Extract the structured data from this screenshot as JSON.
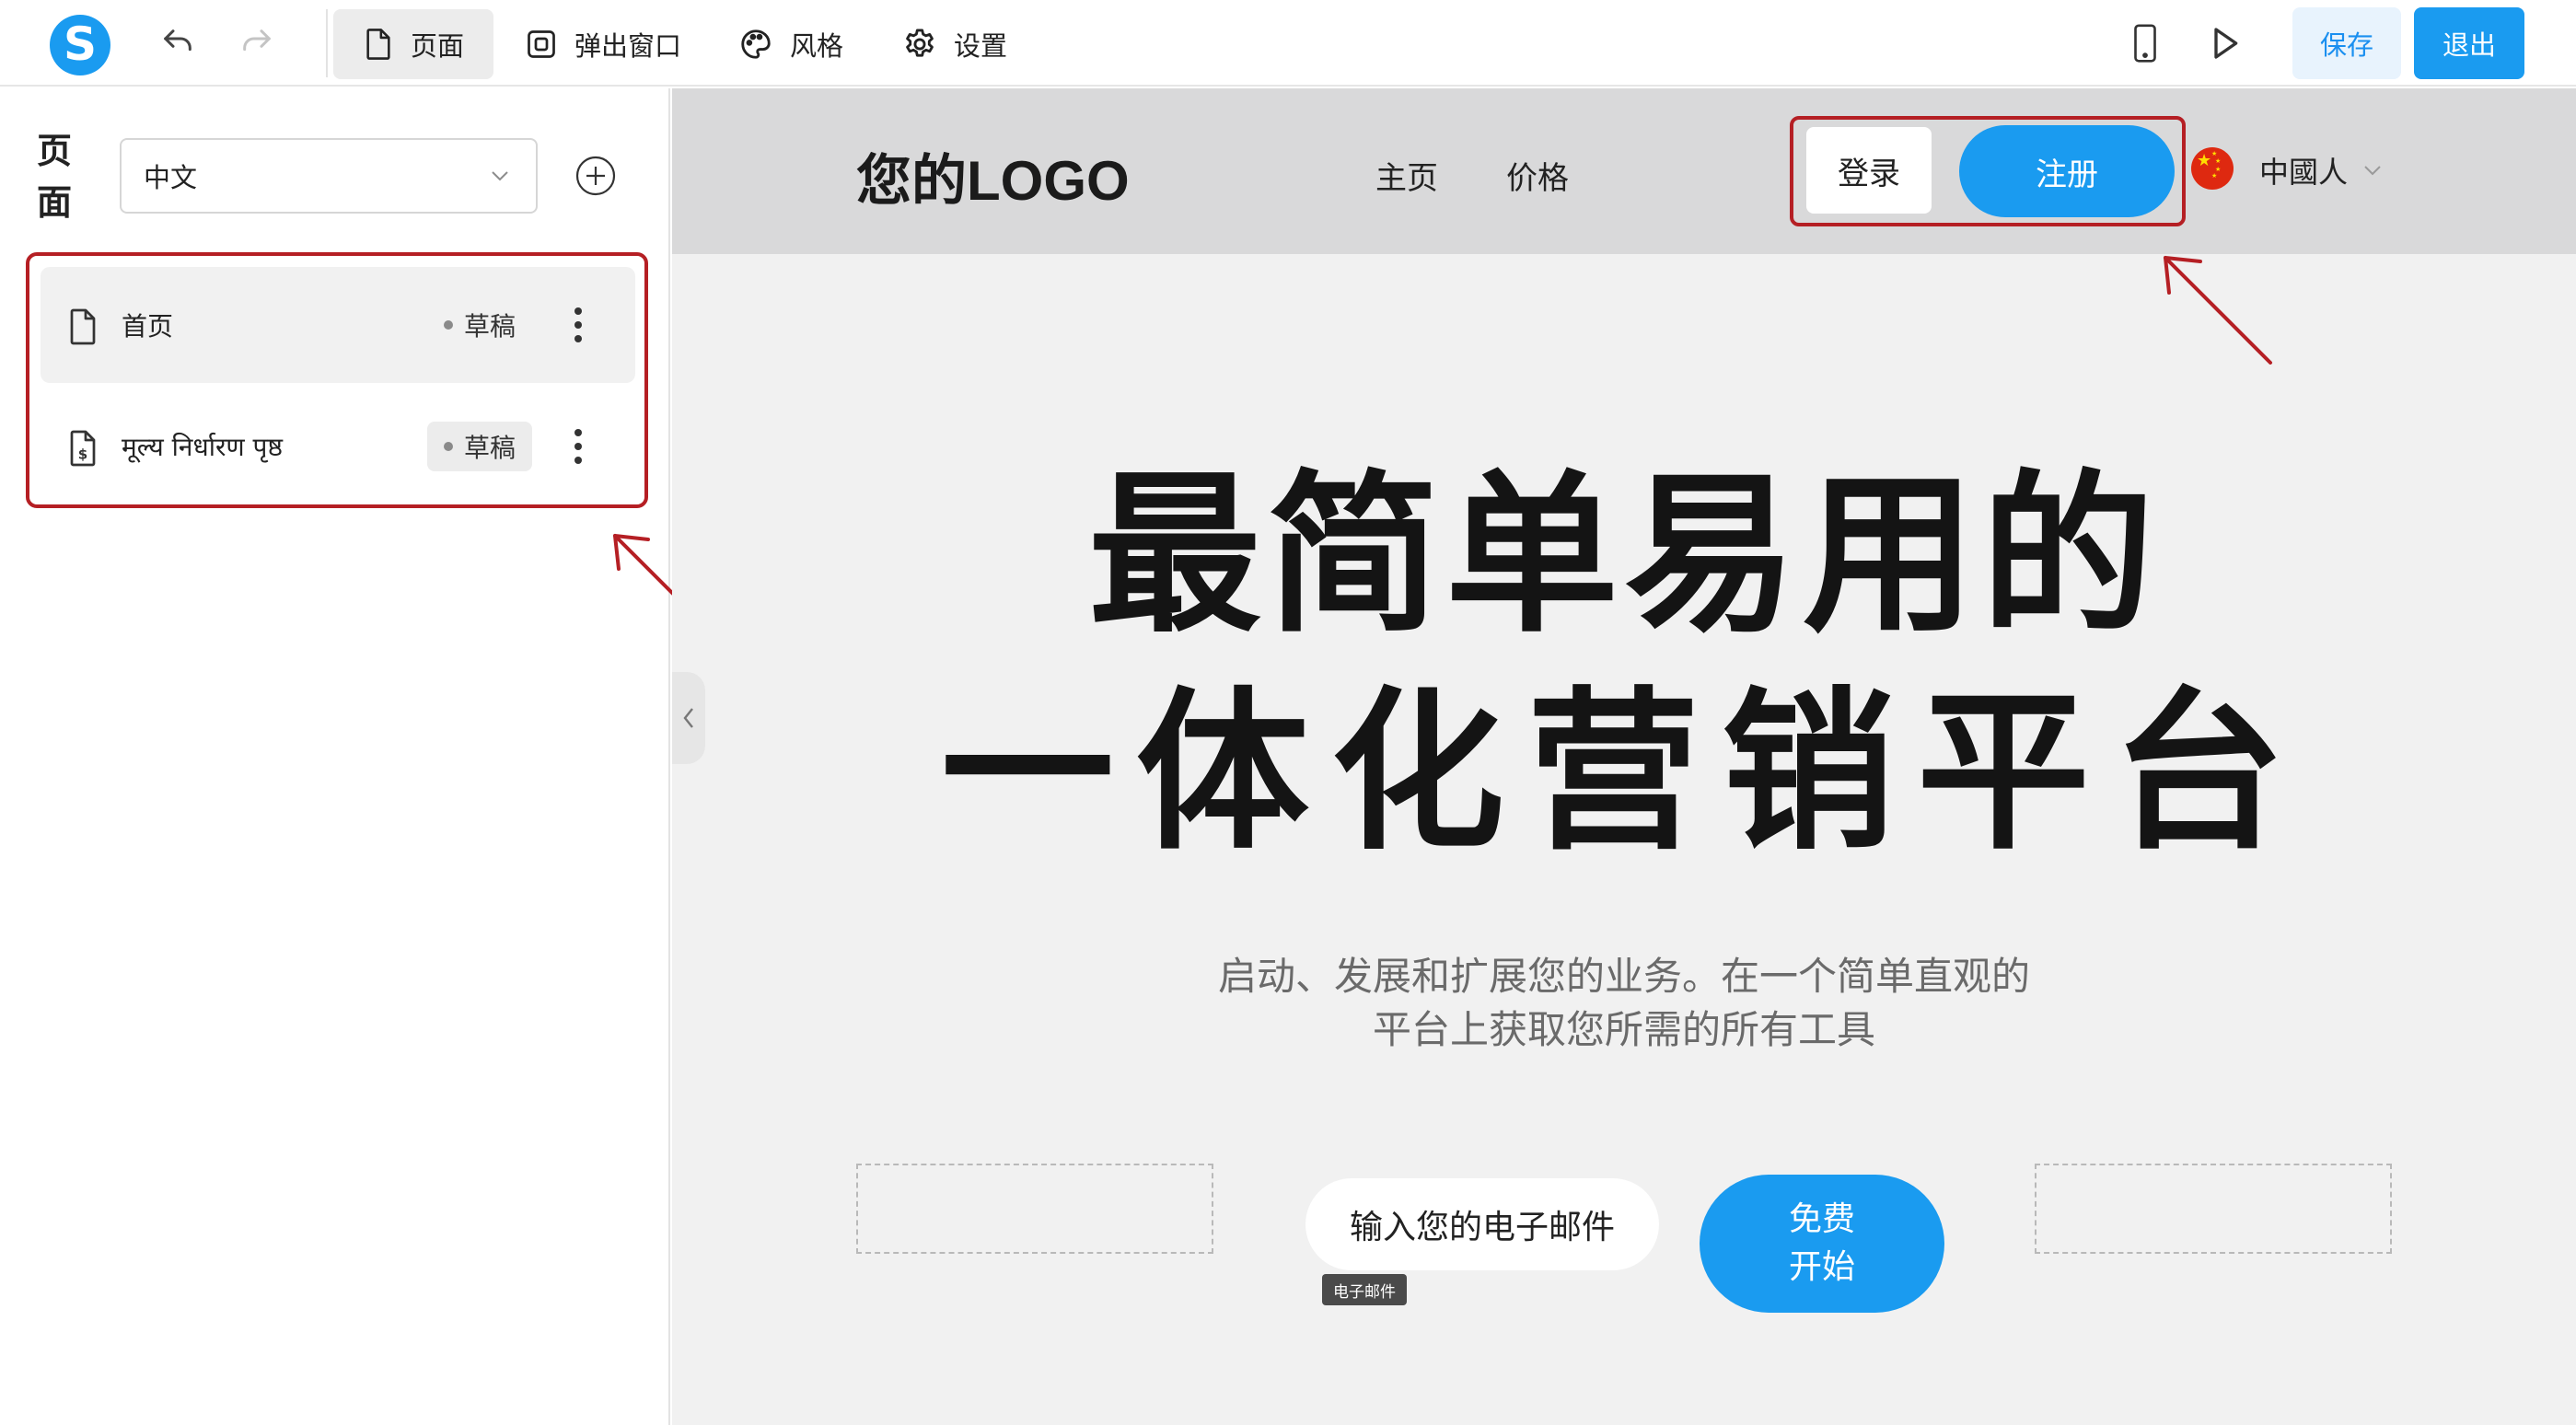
{
  "toolbar": {
    "logo_letter": "S",
    "tabs": [
      {
        "label": "页面",
        "icon": "page-icon",
        "active": true
      },
      {
        "label": "弹出窗口",
        "icon": "popup-icon",
        "active": false
      },
      {
        "label": "风格",
        "icon": "palette-icon",
        "active": false
      },
      {
        "label": "设置",
        "icon": "gear-icon",
        "active": false
      }
    ],
    "save_label": "保存",
    "exit_label": "退出"
  },
  "sidebar": {
    "title": "页面",
    "language": "中文",
    "pages": [
      {
        "label": "首页",
        "status": "草稿",
        "icon": "page-icon"
      },
      {
        "label": "मूल्य निर्धारण पृष्ठ",
        "status": "草稿",
        "icon": "dollar-page-icon"
      }
    ]
  },
  "site": {
    "logo": "您的LOGO",
    "nav": [
      "主页",
      "价格"
    ],
    "login_label": "登录",
    "signup_label": "注册",
    "language": "中國人",
    "hero_line1": "最简单易用的",
    "hero_line2": "一体化营销平台",
    "subtitle_line1": "启动、发展和扩展您的业务。在一个简单直观的",
    "subtitle_line2": "平台上获取您所需的所有工具",
    "email_placeholder": "输入您的电子邮件",
    "email_tag": "电子邮件",
    "cta_line1": "免费",
    "cta_line2": "开始"
  },
  "colors": {
    "accent": "#1a9bf0",
    "annotation": "#b51f24",
    "header_bg": "#d9d9da",
    "canvas_bg": "#f1f1f1"
  }
}
